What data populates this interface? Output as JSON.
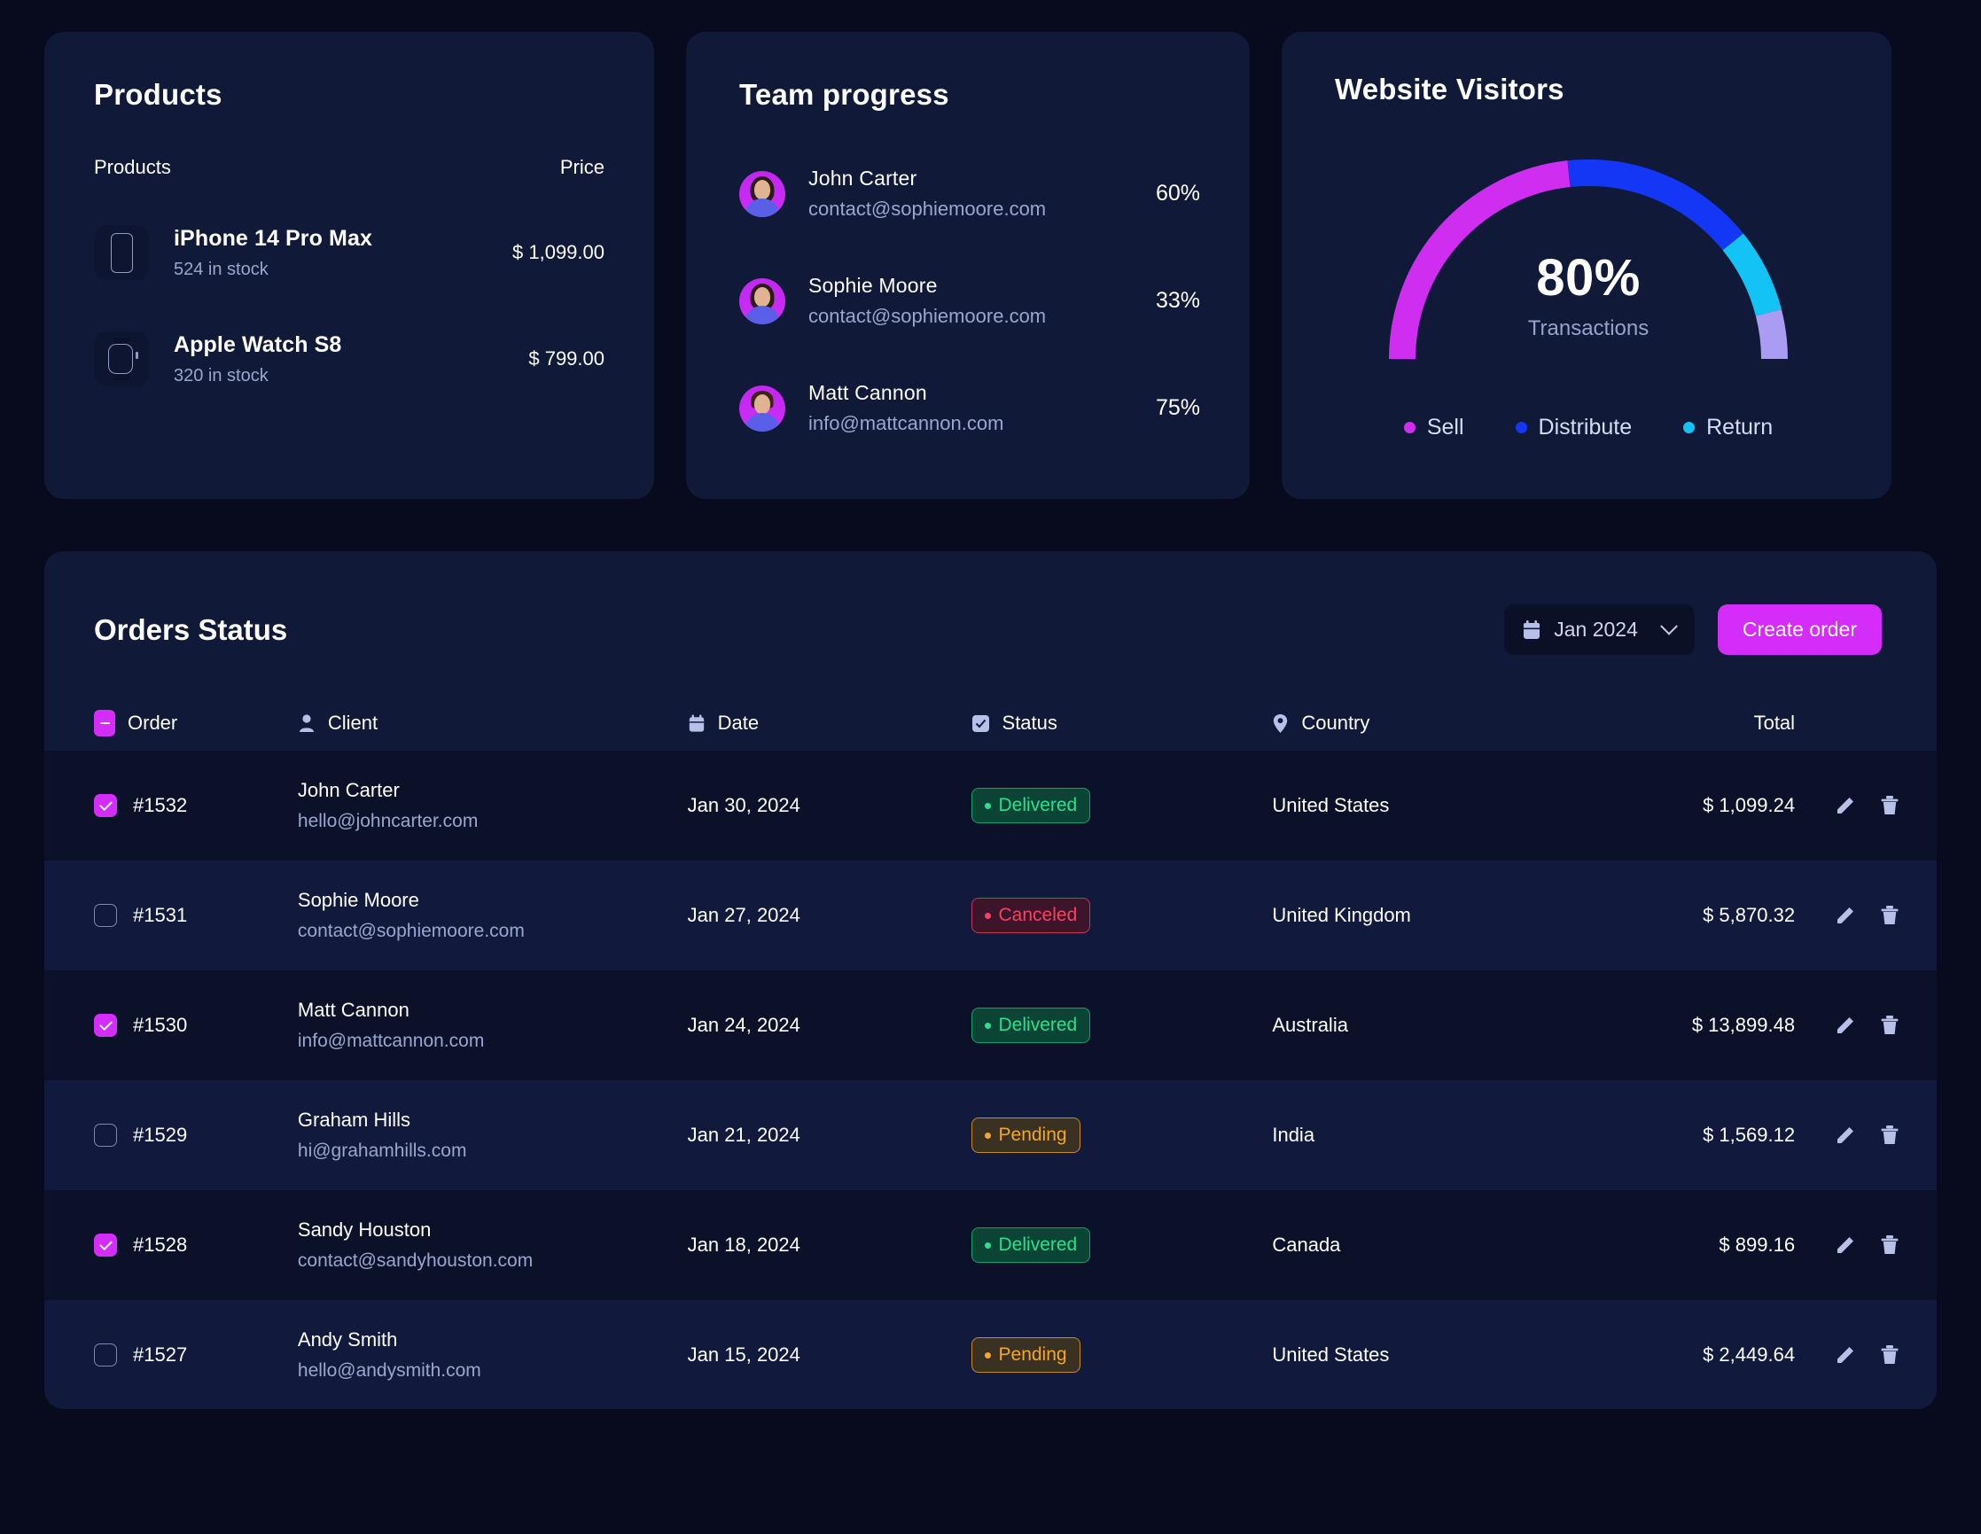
{
  "theme": {
    "page_bg": "#070b1d",
    "card_bg": "#101938",
    "accent": "#d42dfa",
    "muted_text": "#9aa6cf",
    "row_odd_bg": "#0b1128",
    "row_even_bg": "#111a3c"
  },
  "products": {
    "title": "Products",
    "col_product": "Products",
    "col_price": "Price",
    "items": [
      {
        "icon": "iphone-icon",
        "name": "iPhone 14 Pro Max",
        "stock": "524 in stock",
        "price": "$ 1,099.00"
      },
      {
        "icon": "apple-watch-icon",
        "name": "Apple Watch S8",
        "stock": "320 in stock",
        "price": "$ 799.00"
      }
    ]
  },
  "team": {
    "title": "Team progress",
    "members": [
      {
        "avatar": "avatar-john-carter",
        "name": "John Carter",
        "email": "contact@sophiemoore.com",
        "percent": "60%"
      },
      {
        "avatar": "avatar-sophie-moore",
        "name": "Sophie Moore",
        "email": "contact@sophiemoore.com",
        "percent": "33%"
      },
      {
        "avatar": "avatar-matt-cannon",
        "name": "Matt Cannon",
        "email": "info@mattcannon.com",
        "percent": "75%"
      }
    ]
  },
  "visitors": {
    "title": "Website Visitors",
    "value": "80%",
    "value_label": "Transactions",
    "legend": [
      {
        "label": "Sell",
        "color": "#cf2ef0"
      },
      {
        "label": "Distribute",
        "color": "#1436f5"
      },
      {
        "label": "Return",
        "color": "#13c3f5"
      }
    ]
  },
  "chart_data": {
    "type": "pie",
    "title": "Website Visitors",
    "subtitle": "Transactions",
    "center_value": 80,
    "center_unit": "%",
    "shape": "semicircle-gauge",
    "sweep_degrees": 180,
    "categories": [
      "Sell",
      "Distribute",
      "Return",
      "Remaining"
    ],
    "values": [
      53,
      25,
      14,
      8
    ],
    "colors": [
      "#cf2ef0",
      "#1436f5",
      "#13c3f5",
      "#a99cf2"
    ],
    "legend_position": "bottom",
    "grid": false
  },
  "orders": {
    "title": "Orders Status",
    "date_filter": {
      "icon": "calendar-icon",
      "label": "Jan 2024",
      "chevron": "chevron-down-icon"
    },
    "create_button": "Create order",
    "columns": [
      {
        "icon": "checkbox-indeterminate-icon",
        "label": "Order"
      },
      {
        "icon": "user-icon",
        "label": "Client"
      },
      {
        "icon": "calendar-icon",
        "label": "Date"
      },
      {
        "icon": "checkbox-check-icon",
        "label": "Status"
      },
      {
        "icon": "location-pin-icon",
        "label": "Country"
      },
      {
        "icon": "",
        "label": "Total"
      }
    ],
    "rows": [
      {
        "selected": true,
        "id": "#1532",
        "client": "John Carter",
        "email": "hello@johncarter.com",
        "date": "Jan 30, 2024",
        "status": "Delivered",
        "status_kind": "delivered",
        "country": "United States",
        "total": "$ 1,099.24"
      },
      {
        "selected": false,
        "id": "#1531",
        "client": "Sophie Moore",
        "email": "contact@sophiemoore.com",
        "date": "Jan 27, 2024",
        "status": "Canceled",
        "status_kind": "canceled",
        "country": "United Kingdom",
        "total": "$ 5,870.32"
      },
      {
        "selected": true,
        "id": "#1530",
        "client": "Matt Cannon",
        "email": "info@mattcannon.com",
        "date": "Jan 24, 2024",
        "status": "Delivered",
        "status_kind": "delivered",
        "country": "Australia",
        "total": "$ 13,899.48"
      },
      {
        "selected": false,
        "id": "#1529",
        "client": "Graham Hills",
        "email": "hi@grahamhills.com",
        "date": "Jan 21, 2024",
        "status": "Pending",
        "status_kind": "pending",
        "country": "India",
        "total": "$ 1,569.12"
      },
      {
        "selected": true,
        "id": "#1528",
        "client": "Sandy Houston",
        "email": "contact@sandyhouston.com",
        "date": "Jan 18, 2024",
        "status": "Delivered",
        "status_kind": "delivered",
        "country": "Canada",
        "total": "$ 899.16"
      },
      {
        "selected": false,
        "id": "#1527",
        "client": "Andy Smith",
        "email": "hello@andysmith.com",
        "date": "Jan 15, 2024",
        "status": "Pending",
        "status_kind": "pending",
        "country": "United States",
        "total": "$ 2,449.64"
      }
    ],
    "row_actions": [
      {
        "icon": "edit-pencil-icon"
      },
      {
        "icon": "trash-delete-icon"
      }
    ]
  }
}
